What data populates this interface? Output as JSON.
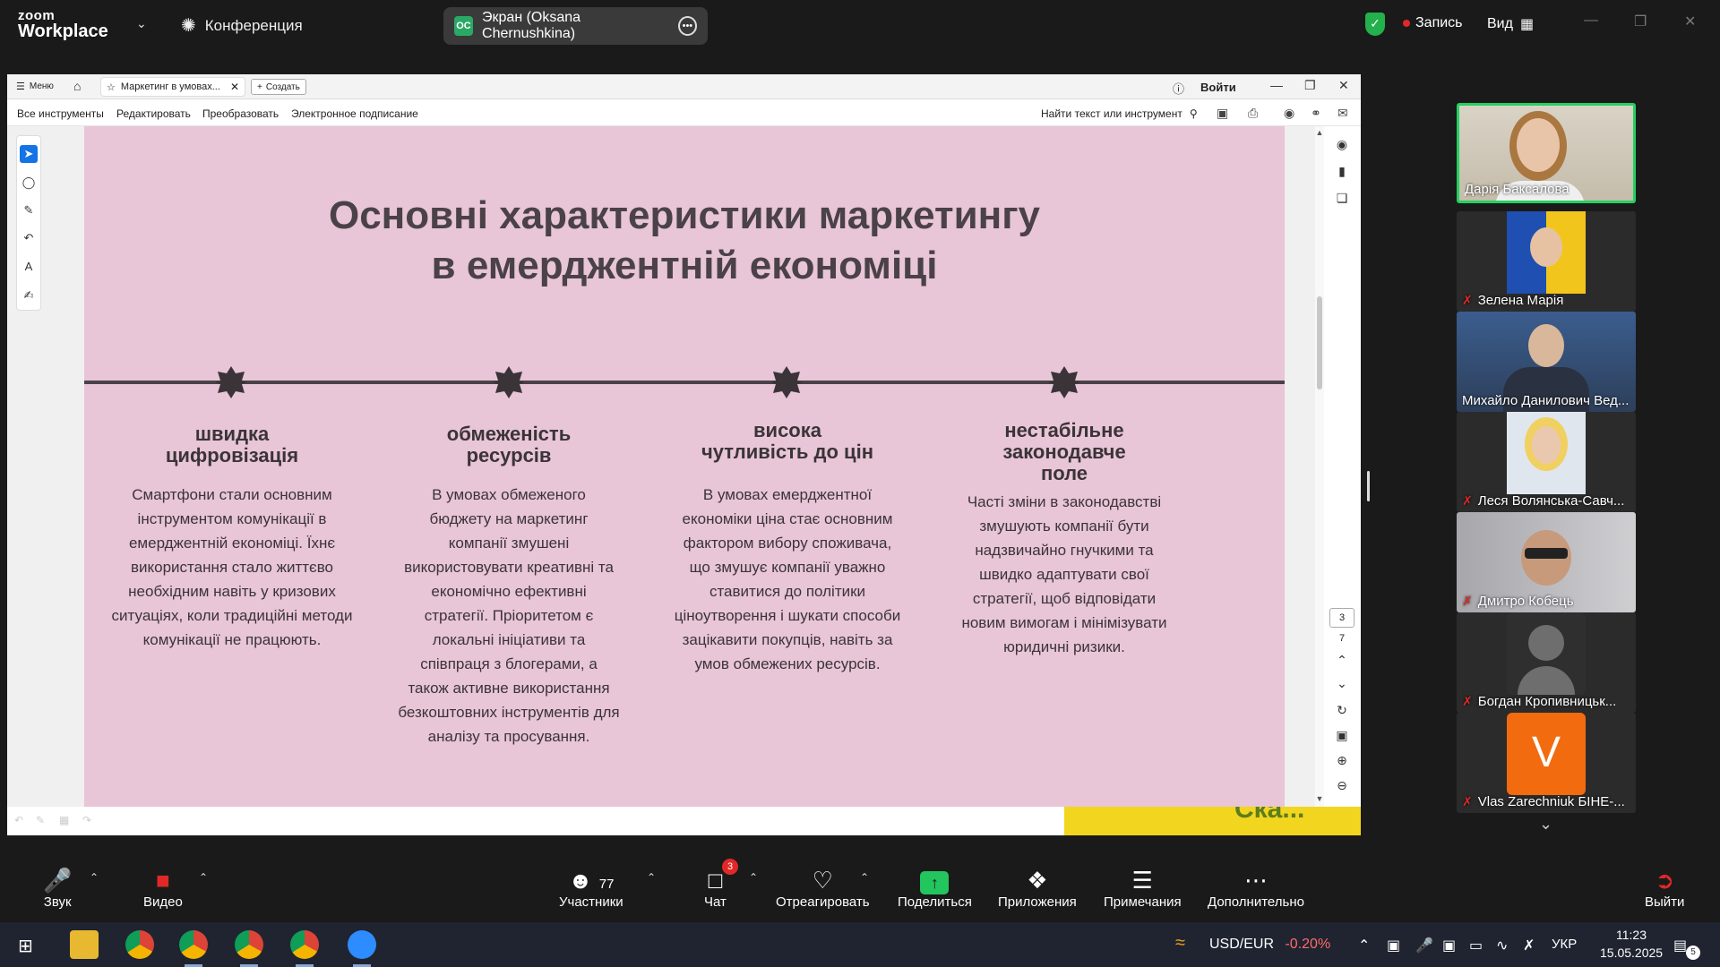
{
  "zoom": {
    "logo_line1": "zoom",
    "logo_line2": "Workplace",
    "meeting_label": "Конференция",
    "share_initials": "OC",
    "share_label": "Экран (Oksana Chernushkina)",
    "record_label": "Запись",
    "view_label": "Вид"
  },
  "pdf": {
    "menu_label": "Меню",
    "tab_title": "Маркетинг в умовах...",
    "new_tab_label": "Создать",
    "login_label": "Войти",
    "tools": [
      "Все инструменты",
      "Редактировать",
      "Преобразовать",
      "Электронное подписание"
    ],
    "find_label": "Найти текст или инструмент",
    "current_page": "3",
    "total_pages": "7"
  },
  "slide": {
    "title_line1": "Основні характеристики маркетингу",
    "title_line2": "в емерджентній економіці",
    "columns": [
      {
        "head": [
          "швидка",
          "цифровізація"
        ],
        "body": [
          "Смартфони стали основним",
          "інструментом комунікації в",
          "емерджентній економіці. Їхнє",
          "використання стало життєво",
          "необхідним навіть у кризових",
          "ситуаціях, коли традиційні методи",
          "комунікації не працюють."
        ]
      },
      {
        "head": [
          "обмеженість",
          "ресурсів"
        ],
        "body": [
          "В умовах обмеженого",
          "бюджету на маркетинг",
          "компанії змушені",
          "використовувати креативні та",
          "економічно ефективні",
          "стратегії. Пріоритетом є",
          "локальні ініціативи та",
          "співпраця з блогерами, а",
          "також активне використання",
          "безкоштовних інструментів для",
          "аналізу та просування."
        ]
      },
      {
        "head": [
          "висока",
          "чутливість до цін"
        ],
        "body": [
          "В умовах емерджентної",
          "економіки ціна стає основним",
          "фактором вибору споживача,",
          "що змушує компанії уважно",
          "ставитися до політики",
          "ціноутворення і шукати способи",
          "зацікавити покупців, навіть за",
          "умов обмежених ресурсів."
        ]
      },
      {
        "head": [
          "нестабільне",
          "законодавче",
          "поле"
        ],
        "body": [
          "Часті зміни в законодавстві",
          "змушують компанії бути",
          "надзвичайно гнучкими та",
          "швидко адаптувати свої",
          "стратегії, щоб відповідати",
          "новим вимогам і мінімізувати",
          "юридичні ризики."
        ]
      }
    ],
    "corner_text": "Ска..."
  },
  "participants": [
    {
      "name": "Дарія Баксалова",
      "muted": false
    },
    {
      "name": "Зелена Марія",
      "muted": true
    },
    {
      "name": "Михайло Данилович Вед...",
      "muted": false
    },
    {
      "name": "Леся Волянська-Савч...",
      "muted": true
    },
    {
      "name": "Дмитро Кобець",
      "muted": true
    },
    {
      "name": "Богдан Кропивницьк...",
      "muted": true
    },
    {
      "name": "Vlas Zarechniuk БІНЕ-...",
      "muted": true,
      "initial": "V"
    }
  ],
  "toolbar": {
    "audio_label": "Звук",
    "video_label": "Видео",
    "participants_label": "Участники",
    "participants_count": "77",
    "chat_label": "Чат",
    "chat_badge": "3",
    "react_label": "Отреагировать",
    "share_label": "Поделиться",
    "apps_label": "Приложения",
    "notes_label": "Примечания",
    "more_label": "Дополнительно",
    "leave_label": "Выйти"
  },
  "taskbar": {
    "ticker": "USD/EUR",
    "ticker_change": "-0.20%",
    "lang": "УКР",
    "time": "11:23",
    "date": "15.05.2025",
    "notifications": "5"
  },
  "colors": {
    "slide_bg": "#e8c5d7",
    "slide_text": "#4a4248",
    "active_speaker": "#23d160",
    "share_green": "#22c55e",
    "mute_red": "#e02828"
  }
}
